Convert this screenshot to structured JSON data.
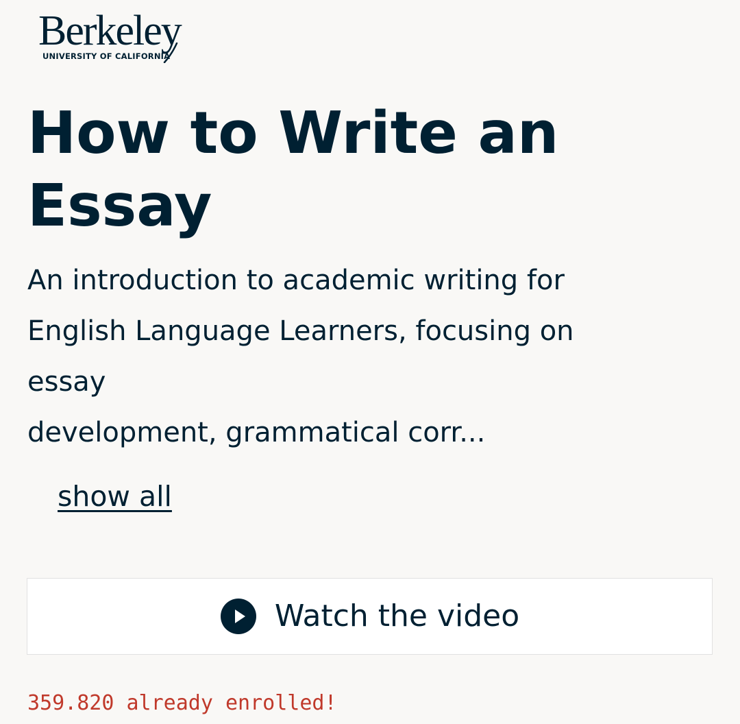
{
  "brand": {
    "name": "Berkeley",
    "subtitle": "UNIVERSITY OF CALIFORNIA"
  },
  "course": {
    "title": "How to Write an Essay",
    "description_lines": [
      "An introduction to academic writing for",
      "English Language Learners, focusing on",
      "essay",
      "development, grammatical corr..."
    ],
    "show_all_label": "show all",
    "video_button_label": "Watch the video",
    "video_icon": "play-circle-icon",
    "enrolled_text": "359.820 already enrolled!"
  },
  "colors": {
    "text": "#002032",
    "enrolled": "#c0392b",
    "background": "#f9f8f6"
  }
}
